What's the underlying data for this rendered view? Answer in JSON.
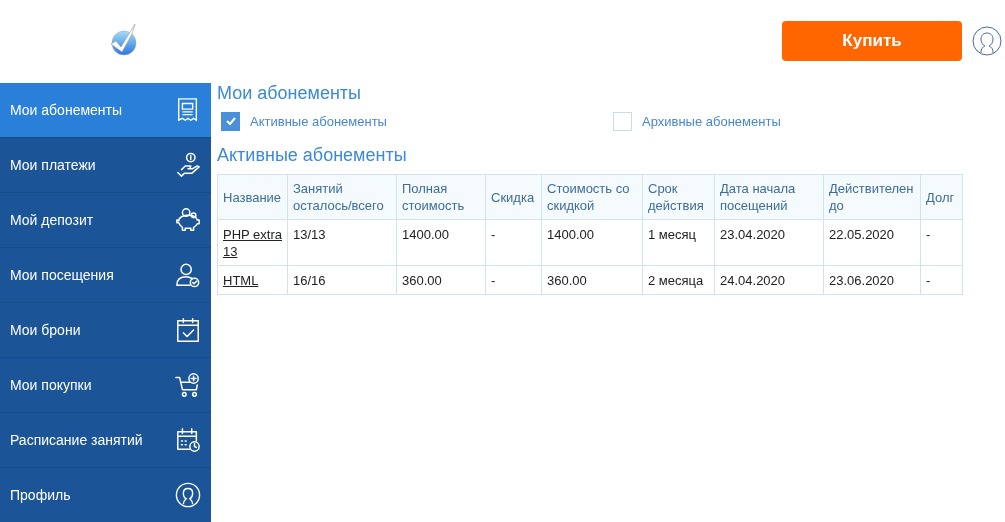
{
  "header": {
    "buy_button": "Купить"
  },
  "sidebar": {
    "items": [
      {
        "label": "Мои абонементы",
        "kind": "receipt",
        "selected": true
      },
      {
        "label": "Мои платежи",
        "kind": "payment",
        "selected": false
      },
      {
        "label": "Мой депозит",
        "kind": "piggy",
        "selected": false
      },
      {
        "label": "Мои посещения",
        "kind": "visits",
        "selected": false
      },
      {
        "label": "Мои брони",
        "kind": "booking",
        "selected": false
      },
      {
        "label": "Мои покупки",
        "kind": "cart",
        "selected": false
      },
      {
        "label": "Расписание занятий",
        "kind": "schedule",
        "selected": false
      },
      {
        "label": "Профиль",
        "kind": "profile",
        "selected": false
      }
    ]
  },
  "page_title": "Мои абонементы",
  "filters": [
    {
      "label": "Активные абонементы",
      "checked": true
    },
    {
      "label": "Архивные абонементы",
      "checked": false
    }
  ],
  "section_title": "Активные абонементы",
  "table": {
    "columns": [
      "Название",
      "Занятий осталось/всего",
      "Полная стоимость",
      "Скидка",
      "Стоимость со скидкой",
      "Срок действия",
      "Дата начала посещений",
      "Действителен до",
      "Долг"
    ],
    "rows": [
      [
        "PHP extra 13",
        "13/13",
        "1400.00",
        "-",
        "1400.00",
        "1 месяц",
        "23.04.2020",
        "22.05.2020",
        "-"
      ],
      [
        "HTML",
        "16/16",
        "360.00",
        "-",
        "360.00",
        "2 месяца",
        "24.04.2020",
        "23.06.2020",
        "-"
      ]
    ]
  }
}
